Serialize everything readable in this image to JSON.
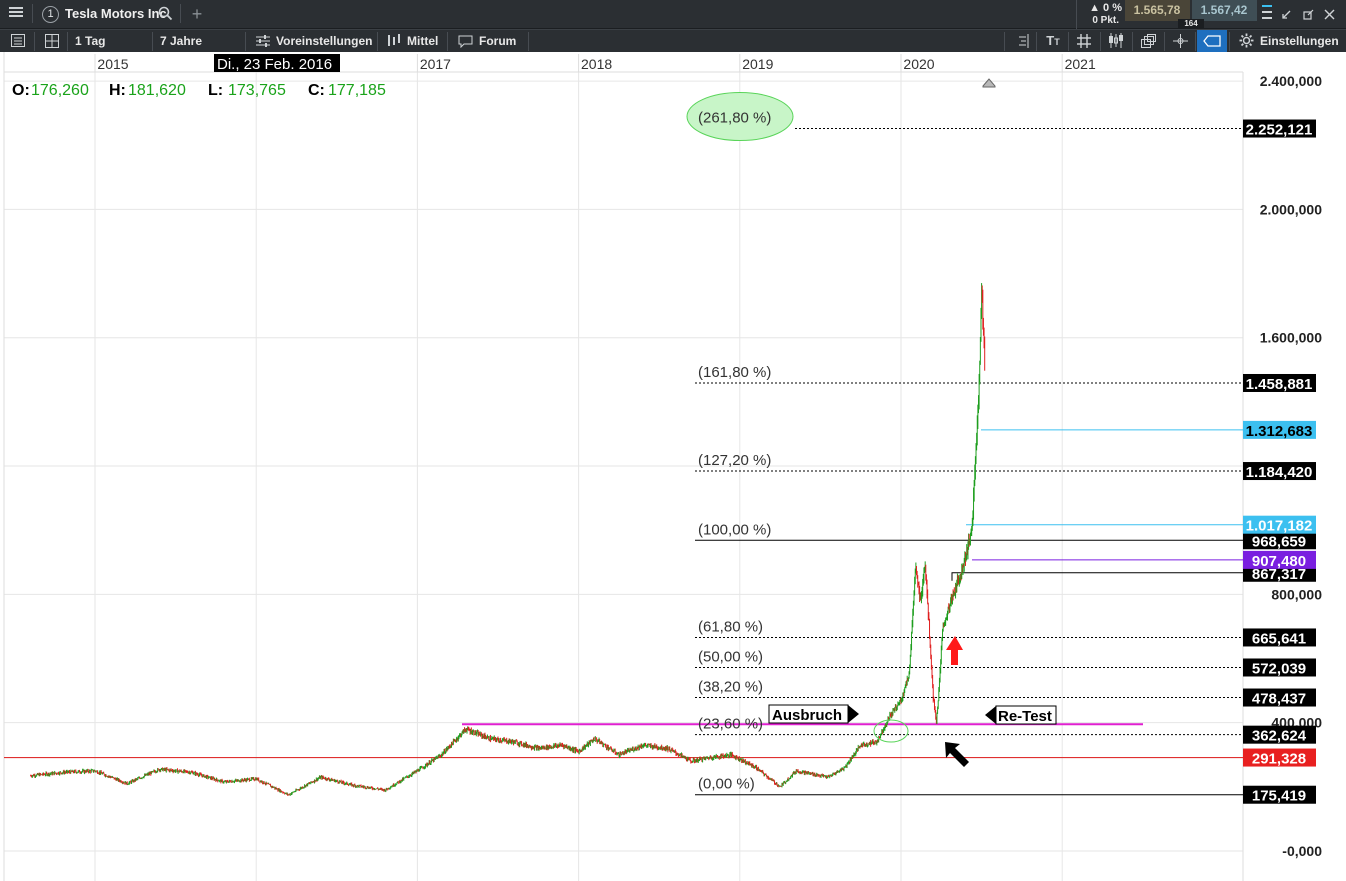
{
  "topbar": {
    "menu_icon": "hamburger-icon",
    "instrument_number": "1",
    "instrument_name": "Tesla Motors Inc",
    "search_icon": "search-icon",
    "add_icon": "plus-icon",
    "change_pct": "▲ 0 %",
    "change_pts": "0 Pkt.",
    "bid": "1.565,78",
    "ask": "1.567,42",
    "spread": "164"
  },
  "toolbar": {
    "interval": "1 Tag",
    "range": "7 Jahre",
    "presets": "Voreinstellungen",
    "average": "Mittel",
    "forum": "Forum",
    "settings": "Einstellungen"
  },
  "colors": {
    "up": "#1e9e1e",
    "down": "#e02020",
    "magenta": "#e020d0",
    "red_line": "#e03030",
    "cyan": "#3cc0f0",
    "purple": "#7a1fe0",
    "bar_bg": "#2b2f33"
  },
  "chart_data": {
    "type": "line",
    "title": "Tesla Motors Inc",
    "ohlc": {
      "o_label": "O:",
      "o": "176,260",
      "h_label": "H:",
      "h": "181,620",
      "l_label": "L:",
      "l": "173,765",
      "c_label": "C:",
      "c": "177,185"
    },
    "crosshair_date": "Di., 23 Feb. 2016",
    "x_ticks": [
      "2015",
      "2017",
      "2018",
      "2019",
      "2020",
      "2021"
    ],
    "y_ticks": [
      "2.400,000",
      "2.000,000",
      "1.600,000",
      "800,000",
      "400,000",
      "-0,000"
    ],
    "ylim": [
      0,
      2400
    ],
    "series": [
      {
        "x": [
          2014.6,
          2014.8,
          2015.0,
          2015.2,
          2015.4,
          2015.6,
          2015.8,
          2016.0,
          2016.2,
          2016.4,
          2016.6,
          2016.8,
          2017.0,
          2017.15,
          2017.3,
          2017.45,
          2017.6,
          2017.75,
          2017.9,
          2018.0,
          2018.1,
          2018.25,
          2018.4,
          2018.55,
          2018.7,
          2018.8,
          2018.95,
          2019.1,
          2019.25,
          2019.35,
          2019.45,
          2019.55,
          2019.65,
          2019.75,
          2019.85,
          2019.93,
          2020.0,
          2020.05,
          2020.09,
          2020.12,
          2020.15,
          2020.18,
          2020.2,
          2020.22,
          2020.24,
          2020.26,
          2020.3,
          2020.34,
          2020.38,
          2020.42,
          2020.44,
          2020.46,
          2020.48,
          2020.5,
          2020.52
        ],
        "values": [
          235,
          245,
          250,
          210,
          255,
          245,
          215,
          225,
          175,
          230,
          205,
          190,
          250,
          300,
          380,
          350,
          340,
          320,
          330,
          310,
          350,
          300,
          330,
          320,
          280,
          290,
          300,
          260,
          200,
          250,
          240,
          230,
          260,
          330,
          340,
          420,
          470,
          550,
          880,
          780,
          900,
          650,
          480,
          400,
          540,
          700,
          760,
          820,
          880,
          960,
          1000,
          1200,
          1400,
          1750,
          1500
        ]
      }
    ],
    "fibonacci": {
      "levels": [
        "(0,00 %)",
        "(23,60 %)",
        "(38,20 %)",
        "(50,00 %)",
        "(61,80 %)",
        "(100,00 %)",
        "(127,20 %)",
        "(161,80 %)",
        "(261,80 %)"
      ],
      "values": [
        175.419,
        362.624,
        478.437,
        572.039,
        665.641,
        968.659,
        1184.42,
        1458.881,
        2252.121
      ]
    },
    "price_labels": [
      "175,419",
      "291,328",
      "362,624",
      "478,437",
      "572,039",
      "665,641",
      "867,317",
      "907,480",
      "968,659",
      "1.017,182",
      "1.184,420",
      "1.312,683",
      "1.458,881",
      "2.252,121"
    ],
    "horizontal_lines": {
      "resistance_magenta": 395,
      "support_red": 291.328,
      "cyan_1": 1312.683,
      "cyan_2": 1017.182,
      "purple": 907.48,
      "black": 867.317
    },
    "annotations": {
      "breakout": "Ausbruch",
      "retest": "Re-Test"
    },
    "grid": true,
    "legend": "none"
  }
}
